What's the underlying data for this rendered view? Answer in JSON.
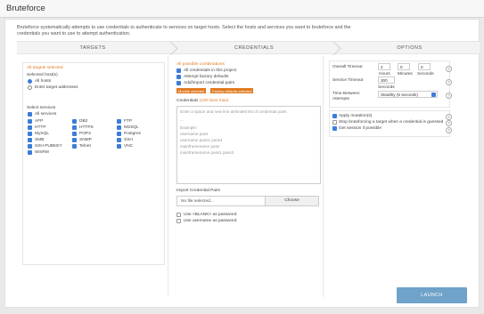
{
  "window": {
    "title": "Bruteforce"
  },
  "intro": "Bruteforce systematically attempts to use credentials to authenticate to services on target hosts. Select the hosts and services you want to bruteforce and the credentials you want to use to attempt authentication.",
  "steps": [
    "TARGETS",
    "CREDENTIALS",
    "OPTIONS"
  ],
  "targets": {
    "heading": "All targets selected",
    "hosts_label": "Selected host(s)",
    "all_hosts": "All hosts",
    "enter_target": "Enter target addresses",
    "services_label": "Select services",
    "all_services": "All services",
    "services": [
      "AFP",
      "DB2",
      "FTP",
      "HTTP",
      "HTTPS",
      "MSSQL",
      "MySQL",
      "POP3",
      "Postgres",
      "SMB",
      "SNMP",
      "SSH",
      "SSH PUBKEY",
      "Telnet",
      "VNC",
      "WinRM"
    ]
  },
  "credentials": {
    "heading": "All possible combinations",
    "options": [
      "All credentials in this project",
      "Attempt factory defaults",
      "Add/import credential pairs"
    ],
    "tags": [
      "Module selected",
      "Factory defaults selected"
    ],
    "pairs_label": "Credentials",
    "pairs_count": "(100 lines max)",
    "textarea_lines": [
      "Enter a space and new line delimited list of credential pairs",
      "...",
      "Example:",
      "username pass",
      "username pass1 pass4",
      "mainframename pass",
      "mainframename pass1 pass2"
    ],
    "import_label": "Import Credential Pairs",
    "file_placeholder": "No file selected...",
    "choose": "Choose",
    "use_blank": "Use <BLANK> as password",
    "use_username": "Use username as password"
  },
  "options": {
    "overall_timeout": "Overall Timeout",
    "hours_val": "4",
    "minutes_val": "0",
    "seconds_val": "0",
    "hours": "Hours",
    "minutes": "Minutes",
    "seconds": "Seconds",
    "service_timeout": "Service Timeout",
    "service_val": "300",
    "service_unit": "Seconds",
    "time_between": "Time Between",
    "attempts": "Attempts",
    "time_between_val": "Stealthy (5 seconds)",
    "checks": [
      "Apply mutation(s)",
      "Stop bruteforcing a target when a credential is guessed",
      "Get session if possible"
    ],
    "check_states": [
      true,
      false,
      true
    ]
  },
  "launch": "LAUNCH",
  "colors": {
    "accent": "#3b7dd8",
    "orange": "#e07b22",
    "launch": "#6fa3c9"
  }
}
